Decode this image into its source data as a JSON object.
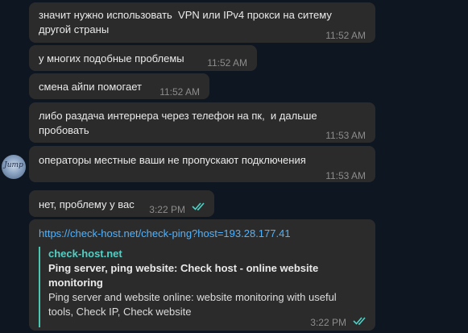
{
  "messages": [
    {
      "text": "значит нужно использовать  VPN или IPv4 прокси на ситему\nдругой страны",
      "time": "11:52 AM"
    },
    {
      "text": "у многих подобные проблемы",
      "time": "11:52 AM"
    },
    {
      "text": "смена айпи помогает",
      "time": "11:52 AM"
    },
    {
      "text": "либо раздача интернера через телефон на пк,  и дальше\nпробовать",
      "time": "11:53 AM"
    },
    {
      "text": "операторы местные ваши не пропускают подключения",
      "time": "11:53 AM"
    },
    {
      "text": "нет, проблему у вас",
      "time": "3:22 PM",
      "status": "read"
    },
    {
      "link": "https://check-host.net/check-ping?host=193.28.177.41",
      "preview": {
        "site": "check-host.net",
        "title": "Ping server, ping website: Check host - online website\nmonitoring",
        "description": "Ping server and website online: website monitoring with useful\ntools, Check IP, Check website"
      },
      "time": "3:22 PM",
      "status": "read"
    }
  ],
  "avatar": {
    "label": "Jump"
  },
  "colors": {
    "background": "#0e1621",
    "bubble": "#2b2b2b",
    "link": "#4fb3ff",
    "preview_accent": "#48c7b1",
    "check": "#4fd1c5"
  }
}
